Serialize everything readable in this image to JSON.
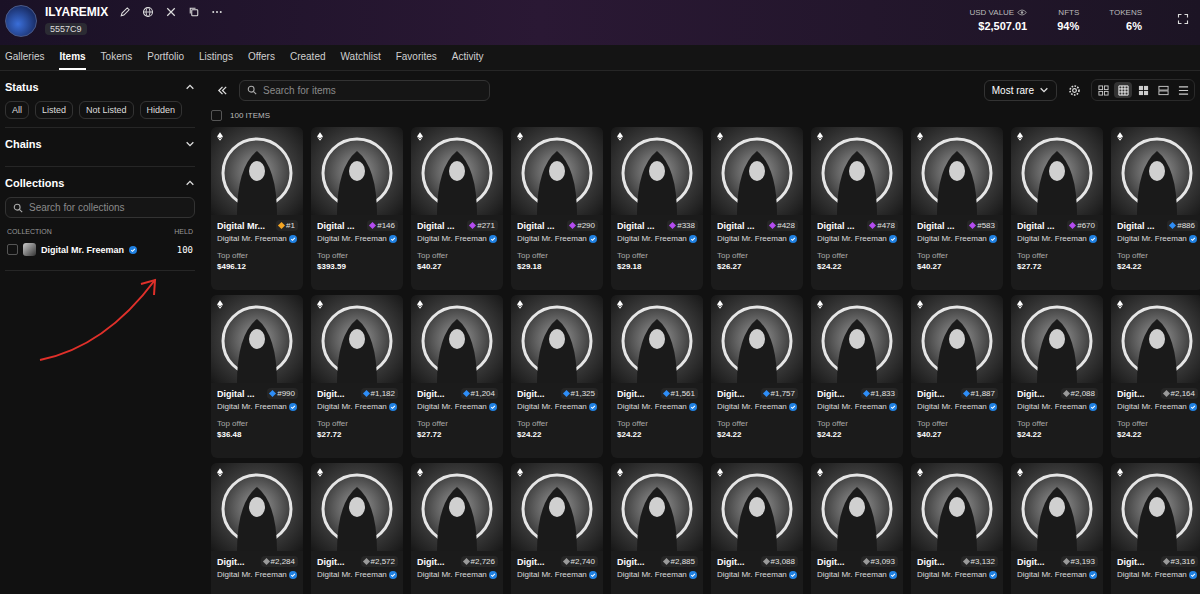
{
  "profile": {
    "name": "ILYAREMIX",
    "address": "5557C9"
  },
  "stats": [
    {
      "label": "USD VALUE",
      "value": "$2,507.01"
    },
    {
      "label": "NFTS",
      "value": "94%"
    },
    {
      "label": "TOKENS",
      "value": "6%"
    }
  ],
  "tabs": [
    {
      "label": "Galleries",
      "selected": false
    },
    {
      "label": "Items",
      "selected": true
    },
    {
      "label": "Tokens",
      "selected": false
    },
    {
      "label": "Portfolio",
      "selected": false
    },
    {
      "label": "Listings",
      "selected": false
    },
    {
      "label": "Offers",
      "selected": false
    },
    {
      "label": "Created",
      "selected": false
    },
    {
      "label": "Watchlist",
      "selected": false
    },
    {
      "label": "Favorites",
      "selected": false
    },
    {
      "label": "Activity",
      "selected": false
    }
  ],
  "sidebar": {
    "sections": [
      {
        "kind": "status",
        "title": "Status",
        "expanded": true,
        "options": [
          {
            "label": "All",
            "selected": false
          },
          {
            "label": "Listed",
            "selected": false
          },
          {
            "label": "Not Listed",
            "selected": false
          },
          {
            "label": "Hidden",
            "selected": false
          }
        ]
      },
      {
        "kind": "chains",
        "title": "Chains",
        "expanded": false
      },
      {
        "kind": "collections",
        "title": "Collections",
        "expanded": true,
        "search_placeholder": "Search for collections",
        "columns": [
          "COLLECTION",
          "HELD"
        ],
        "rows": [
          {
            "name": "Digital Mr. Freeman",
            "verified": true,
            "held": "100",
            "checked": false
          }
        ]
      }
    ]
  },
  "toolbar": {
    "search_placeholder": "Search for items",
    "sort": "Most rare",
    "views": [
      {
        "kind": "large",
        "selected": false
      },
      {
        "kind": "medium",
        "selected": true
      },
      {
        "kind": "small",
        "selected": false
      },
      {
        "kind": "list",
        "selected": false
      },
      {
        "kind": "table",
        "selected": false
      }
    ]
  },
  "items_count": "100 ITEMS",
  "items": [
    {
      "title": "Digital Mr...",
      "rank": "#1",
      "color": "#f5a623",
      "collection": "Digital Mr. Freeman",
      "verified": true,
      "offer_label": "Top offer",
      "price": "$496.12"
    },
    {
      "title": "Digital ...",
      "rank": "#146",
      "color": "#b44cf0",
      "collection": "Digital Mr. Freeman",
      "verified": true,
      "offer_label": "Top offer",
      "price": "$393.59"
    },
    {
      "title": "Digital ...",
      "rank": "#271",
      "color": "#b44cf0",
      "collection": "Digital Mr. Freeman",
      "verified": true,
      "offer_label": "Top offer",
      "price": "$40.27"
    },
    {
      "title": "Digital ...",
      "rank": "#290",
      "color": "#b44cf0",
      "collection": "Digital Mr. Freeman",
      "verified": true,
      "offer_label": "Top offer",
      "price": "$29.18"
    },
    {
      "title": "Digital ...",
      "rank": "#338",
      "color": "#b44cf0",
      "collection": "Digital Mr. Freeman",
      "verified": true,
      "offer_label": "Top offer",
      "price": "$29.18"
    },
    {
      "title": "Digital ...",
      "rank": "#428",
      "color": "#b44cf0",
      "collection": "Digital Mr. Freeman",
      "verified": true,
      "offer_label": "Top offer",
      "price": "$26.27"
    },
    {
      "title": "Digital ...",
      "rank": "#478",
      "color": "#b44cf0",
      "collection": "Digital Mr. Freeman",
      "verified": true,
      "offer_label": "Top offer",
      "price": "$24.22"
    },
    {
      "title": "Digital ...",
      "rank": "#583",
      "color": "#b44cf0",
      "collection": "Digital Mr. Freeman",
      "verified": true,
      "offer_label": "Top offer",
      "price": "$40.27"
    },
    {
      "title": "Digital ...",
      "rank": "#670",
      "color": "#b44cf0",
      "collection": "Digital Mr. Freeman",
      "verified": true,
      "offer_label": "Top offer",
      "price": "$27.72"
    },
    {
      "title": "Digital ...",
      "rank": "#886",
      "color": "#2e8ef7",
      "collection": "Digital Mr. Freeman",
      "verified": true,
      "offer_label": "Top offer",
      "price": "$24.22"
    },
    {
      "title": "Digital ...",
      "rank": "#990",
      "color": "#2e8ef7",
      "collection": "Digital Mr. Freeman",
      "verified": true,
      "offer_label": "Top offer",
      "price": "$36.48"
    },
    {
      "title": "Digit...",
      "rank": "#1,182",
      "color": "#2e8ef7",
      "collection": "Digital Mr. Freeman",
      "verified": true,
      "offer_label": "Top offer",
      "price": "$27.72"
    },
    {
      "title": "Digit...",
      "rank": "#1,204",
      "color": "#2e8ef7",
      "collection": "Digital Mr. Freeman",
      "verified": true,
      "offer_label": "Top offer",
      "price": "$27.72"
    },
    {
      "title": "Digit...",
      "rank": "#1,325",
      "color": "#2e8ef7",
      "collection": "Digital Mr. Freeman",
      "verified": true,
      "offer_label": "Top offer",
      "price": "$24.22"
    },
    {
      "title": "Digit...",
      "rank": "#1,561",
      "color": "#2e8ef7",
      "collection": "Digital Mr. Freeman",
      "verified": true,
      "offer_label": "Top offer",
      "price": "$24.22"
    },
    {
      "title": "Digit...",
      "rank": "#1,757",
      "color": "#2e8ef7",
      "collection": "Digital Mr. Freeman",
      "verified": true,
      "offer_label": "Top offer",
      "price": "$24.22"
    },
    {
      "title": "Digit...",
      "rank": "#1,833",
      "color": "#2e8ef7",
      "collection": "Digital Mr. Freeman",
      "verified": true,
      "offer_label": "Top offer",
      "price": "$24.22"
    },
    {
      "title": "Digit...",
      "rank": "#1,887",
      "color": "#2e8ef7",
      "collection": "Digital Mr. Freeman",
      "verified": true,
      "offer_label": "Top offer",
      "price": "$40.27"
    },
    {
      "title": "Digit...",
      "rank": "#2,088",
      "color": "#9a9a9a",
      "collection": "Digital Mr. Freeman",
      "verified": true,
      "offer_label": "Top offer",
      "price": "$24.22"
    },
    {
      "title": "Digit...",
      "rank": "#2,164",
      "color": "#9a9a9a",
      "collection": "Digital Mr. Freeman",
      "verified": true,
      "offer_label": "Top offer",
      "price": "$24.22"
    },
    {
      "title": "Digit...",
      "rank": "#2,284",
      "color": "#9a9a9a",
      "collection": "Digital Mr. Freeman",
      "verified": true
    },
    {
      "title": "Digit...",
      "rank": "#2,572",
      "color": "#9a9a9a",
      "collection": "Digital Mr. Freeman",
      "verified": true
    },
    {
      "title": "Digit...",
      "rank": "#2,726",
      "color": "#9a9a9a",
      "collection": "Digital Mr. Freeman",
      "verified": true
    },
    {
      "title": "Digit...",
      "rank": "#2,740",
      "color": "#9a9a9a",
      "collection": "Digital Mr. Freeman",
      "verified": true
    },
    {
      "title": "Digit...",
      "rank": "#2,885",
      "color": "#9a9a9a",
      "collection": "Digital Mr. Freeman",
      "verified": true
    },
    {
      "title": "Digit...",
      "rank": "#3,088",
      "color": "#9a9a9a",
      "collection": "Digital Mr. Freeman",
      "verified": true
    },
    {
      "title": "Digit...",
      "rank": "#3,093",
      "color": "#9a9a9a",
      "collection": "Digital Mr. Freeman",
      "verified": true
    },
    {
      "title": "Digit...",
      "rank": "#3,132",
      "color": "#9a9a9a",
      "collection": "Digital Mr. Freeman",
      "verified": true
    },
    {
      "title": "Digit...",
      "rank": "#3,193",
      "color": "#9a9a9a",
      "collection": "Digital Mr. Freeman",
      "verified": true
    },
    {
      "title": "Digit...",
      "rank": "#3,316",
      "color": "#9a9a9a",
      "collection": "Digital Mr. Freeman",
      "verified": true
    }
  ]
}
